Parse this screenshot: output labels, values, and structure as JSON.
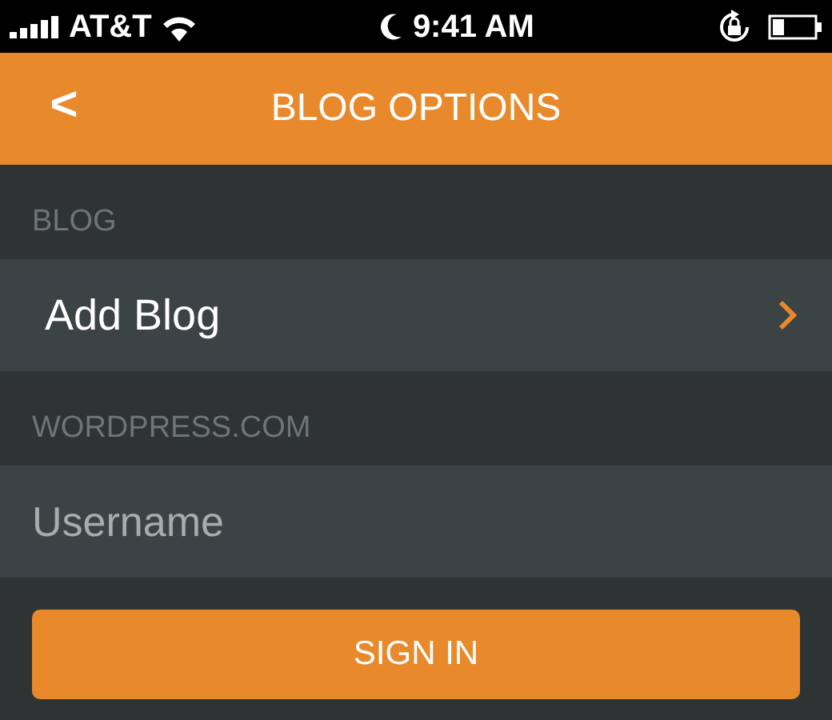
{
  "status_bar": {
    "carrier": "AT&T",
    "time": "9:41 AM"
  },
  "header": {
    "back": "<",
    "title": "BLOG OPTIONS"
  },
  "sections": [
    {
      "heading": "BLOG",
      "kind": "link",
      "label": "Add Blog"
    },
    {
      "heading": "WORDPRESS.COM",
      "kind": "input",
      "placeholder": "Username"
    }
  ],
  "button": "SIGN IN"
}
